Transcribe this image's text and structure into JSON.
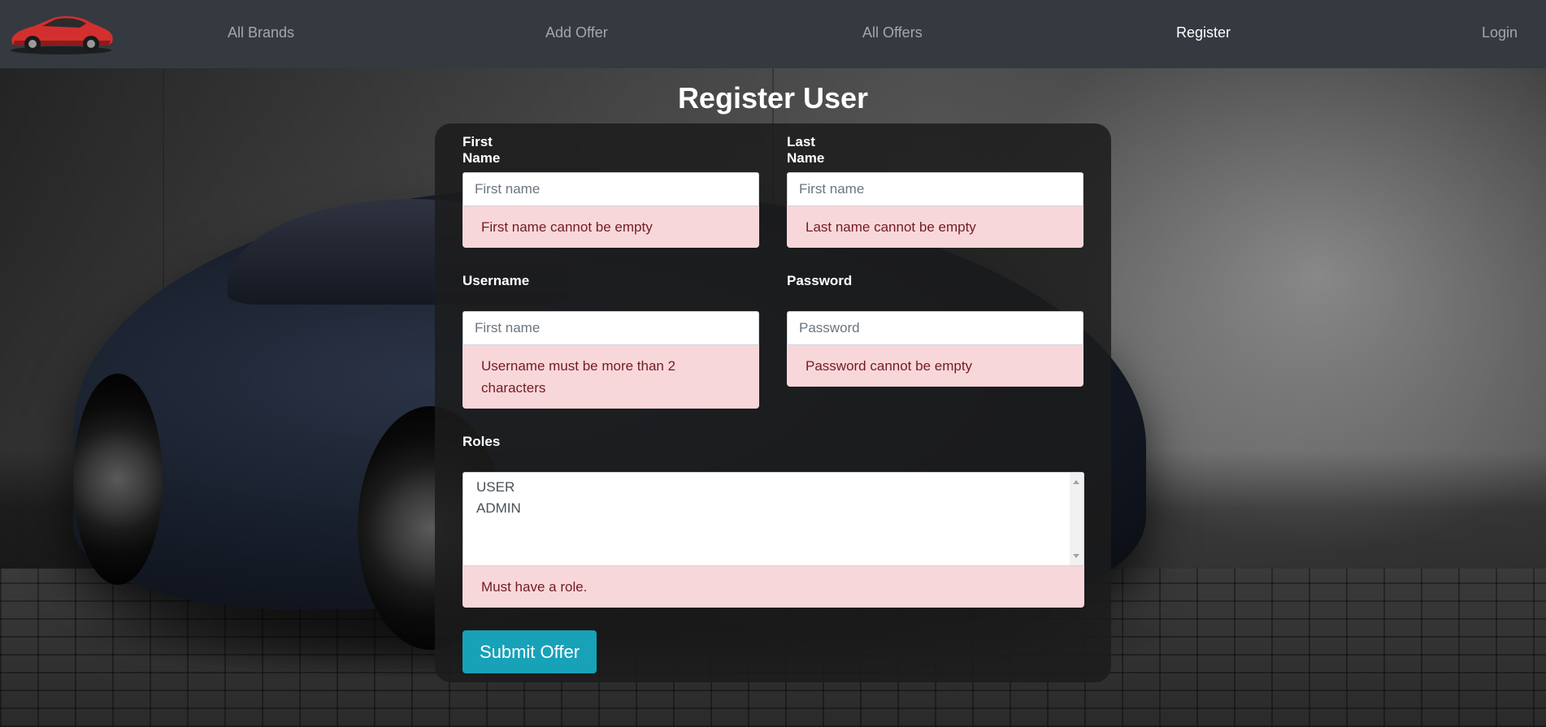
{
  "nav": {
    "items": [
      {
        "label": "All Brands"
      },
      {
        "label": "Add Offer"
      },
      {
        "label": "All Offers"
      },
      {
        "label": "Register"
      },
      {
        "label": "Login"
      }
    ]
  },
  "main": {
    "title": "Register User",
    "fields": {
      "first_name": {
        "label": "First Name",
        "placeholder": "First name",
        "value": "",
        "error": "First name cannot be empty"
      },
      "last_name": {
        "label": "Last Name",
        "placeholder": "First name",
        "value": "",
        "error": "Last name cannot be empty"
      },
      "username": {
        "label": "Username",
        "placeholder": "First name",
        "value": "",
        "error": "Username must be more than 2 characters"
      },
      "password": {
        "label": "Password",
        "placeholder": "Password",
        "value": "",
        "error": "Password cannot be empty"
      }
    },
    "roles": {
      "label": "Roles",
      "options": [
        "USER",
        "ADMIN"
      ],
      "error": "Must have a role."
    },
    "submit_label": "Submit Offer"
  },
  "colors": {
    "navbar": "#343a40",
    "error_bg": "#f8d7da",
    "error_text": "#721c24",
    "submit_bg": "#17a2b8",
    "logo_car": "#d32f2f"
  }
}
